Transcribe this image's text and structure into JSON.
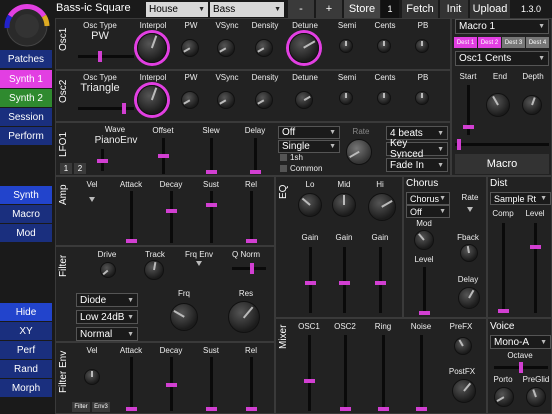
{
  "topbar": {
    "preset_name": "Bass-ic Square",
    "category": "House",
    "subcategory": "Bass",
    "minus": "-",
    "plus": "+",
    "store": "Store",
    "slot": "1",
    "fetch": "Fetch",
    "init": "Init",
    "upload": "Upload",
    "version": "1.3.0"
  },
  "nav": {
    "patches": "Patches",
    "synth1": "Synth 1",
    "synth2": "Synth 2",
    "session": "Session",
    "perform": "Perform",
    "synth": "Synth",
    "macro": "Macro",
    "mod": "Mod",
    "hide": "Hide",
    "xy": "XY",
    "perf": "Perf",
    "rand": "Rand",
    "morph": "Morph"
  },
  "osc1": {
    "section": "Osc1",
    "osc_type_label": "Osc Type",
    "osc_type": "PW",
    "knobs": [
      "Interpol",
      "PW",
      "VSync",
      "Density",
      "Detune",
      "Semi",
      "Cents",
      "PB"
    ]
  },
  "osc2": {
    "section": "Osc2",
    "osc_type_label": "Osc Type",
    "osc_type": "Triangle",
    "knobs": [
      "Interpol",
      "PW",
      "VSync",
      "Density",
      "Detune",
      "Semi",
      "Cents",
      "PB"
    ]
  },
  "lfo1": {
    "section": "LFO1",
    "wave_label": "Wave",
    "wave": "PianoEnv",
    "tab1": "1",
    "tab2": "2",
    "offset": "Offset",
    "slew": "Slew",
    "delay": "Delay",
    "mode": "Off",
    "trigger": "Single",
    "opt1": "1sh",
    "opt2": "Common",
    "rate": "Rate",
    "beats": "4 beats",
    "sync": "Key Synced",
    "fade": "Fade In"
  },
  "macro": {
    "select": "Macro 1",
    "dests": [
      "Dest 1",
      "Dest 2",
      "Dest 3",
      "Dest 4"
    ],
    "target": "Osc1 Cents",
    "start": "Start",
    "end": "End",
    "depth": "Depth",
    "button": "Macro"
  },
  "amp": {
    "section": "Amp",
    "vel": "Vel",
    "attack": "Attack",
    "decay": "Decay",
    "sust": "Sust",
    "rel": "Rel"
  },
  "filter": {
    "section": "Filter",
    "drive": "Drive",
    "track": "Track",
    "frq_env": "Frq Env",
    "q_norm": "Q Norm",
    "frq": "Frq",
    "res": "Res",
    "type": "Diode",
    "slope": "Low 24dB",
    "mode": "Normal"
  },
  "filter_env": {
    "section": "Filter Env",
    "vel": "Vel",
    "attack": "Attack",
    "decay": "Decay",
    "sust": "Sust",
    "rel": "Rel",
    "tab_filter": "Filter",
    "tab_env3": "Env3"
  },
  "eq": {
    "section": "EQ",
    "lo": "Lo",
    "mid": "Mid",
    "hi": "Hi",
    "gain": "Gain"
  },
  "chorus": {
    "section": "Chorus",
    "type": "Chorus",
    "state": "Off",
    "rate": "Rate",
    "mod": "Mod",
    "fback": "Fback",
    "level": "Level",
    "delay": "Delay"
  },
  "dist": {
    "section": "Dist",
    "type": "Sample Rt",
    "comp": "Comp",
    "level": "Level"
  },
  "mixer": {
    "section": "Mixer",
    "channels": [
      "OSC1",
      "OSC2",
      "Ring",
      "Noise",
      "PreFX"
    ],
    "postfx": "PostFX"
  },
  "voice": {
    "section": "Voice",
    "mode": "Mono-A",
    "octave": "Octave",
    "porto": "Porto",
    "preglid": "PreGlid"
  },
  "colors": {
    "accent": "#e23fe2",
    "green": "#2f8a2f",
    "blue": "#1a2f7e"
  }
}
